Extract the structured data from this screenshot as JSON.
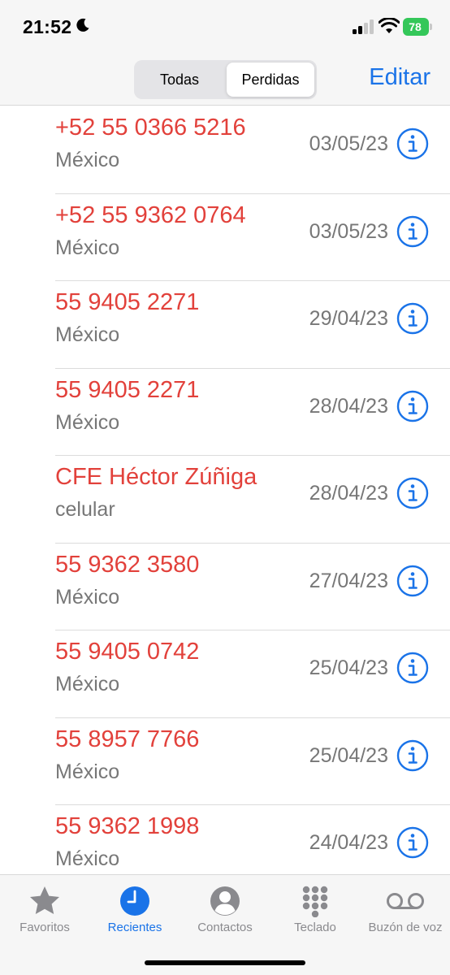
{
  "status": {
    "time": "21:52",
    "battery": "78"
  },
  "nav": {
    "segments": [
      "Todas",
      "Perdidas"
    ],
    "selected": "Perdidas",
    "edit_label": "Editar"
  },
  "calls": [
    {
      "caller": "+52 55 0366 5216",
      "subtitle": "México",
      "date": "03/05/23"
    },
    {
      "caller": "+52 55 9362 0764",
      "subtitle": "México",
      "date": "03/05/23"
    },
    {
      "caller": "55 9405 2271",
      "subtitle": "México",
      "date": "29/04/23"
    },
    {
      "caller": "55 9405 2271",
      "subtitle": "México",
      "date": "28/04/23"
    },
    {
      "caller": "CFE Héctor Zúñiga",
      "subtitle": "celular",
      "date": "28/04/23"
    },
    {
      "caller": "55 9362 3580",
      "subtitle": "México",
      "date": "27/04/23"
    },
    {
      "caller": "55 9405 0742",
      "subtitle": "México",
      "date": "25/04/23"
    },
    {
      "caller": "55 8957 7766",
      "subtitle": "México",
      "date": "25/04/23"
    },
    {
      "caller": "55 9362 1998",
      "subtitle": "México",
      "date": "24/04/23"
    }
  ],
  "tabs": [
    {
      "label": "Favoritos",
      "icon": "star-icon"
    },
    {
      "label": "Recientes",
      "icon": "clock-icon",
      "active": true
    },
    {
      "label": "Contactos",
      "icon": "person-circle-icon"
    },
    {
      "label": "Teclado",
      "icon": "keypad-icon"
    },
    {
      "label": "Buzón de voz",
      "icon": "voicemail-icon"
    }
  ],
  "colors": {
    "missed_call": "#e2413b",
    "accent": "#1a73e8",
    "secondary_text": "#777777",
    "battery": "#34c759"
  }
}
